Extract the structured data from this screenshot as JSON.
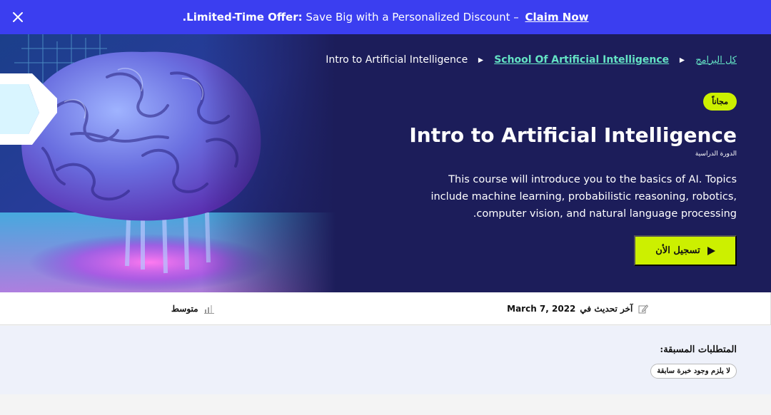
{
  "promo": {
    "bold_label": ".Limited-Time Offer:",
    "text": "Save Big with a Personalized Discount –",
    "link": "Claim Now"
  },
  "breadcrumb": {
    "home": "كل البرامج",
    "school": "School Of Artificial Intelligence",
    "current": "Intro to Artificial Intelligence"
  },
  "course": {
    "badge": "مجاناً",
    "title": "Intro to Artificial Intelligence",
    "type": "الدورة الدراسية",
    "description": "This course will introduce you to the basics of AI. Topics include machine learning, probabilistic reasoning, robotics, .computer vision, and natural language processing",
    "enroll_label": "تسجيل الأن"
  },
  "meta": {
    "level": "متوسط",
    "updated_label": "آخر تحديث في",
    "updated_date": "March 7, 2022"
  },
  "prerequisites": {
    "heading": "المتطلبات المسبقة:",
    "items": [
      "لا يلزم وجود خبرة سابقة"
    ]
  },
  "colors": {
    "promo_bg": "#3b3ef0",
    "hero_bg": "#1c1d5a",
    "accent": "#ccf000",
    "link": "#64e3c4"
  },
  "icons": {
    "close": "close-icon",
    "breadcrumb_sep": "triangle-right-icon",
    "enroll": "play-icon",
    "level": "bar-chart-icon",
    "updated": "edit-icon"
  }
}
